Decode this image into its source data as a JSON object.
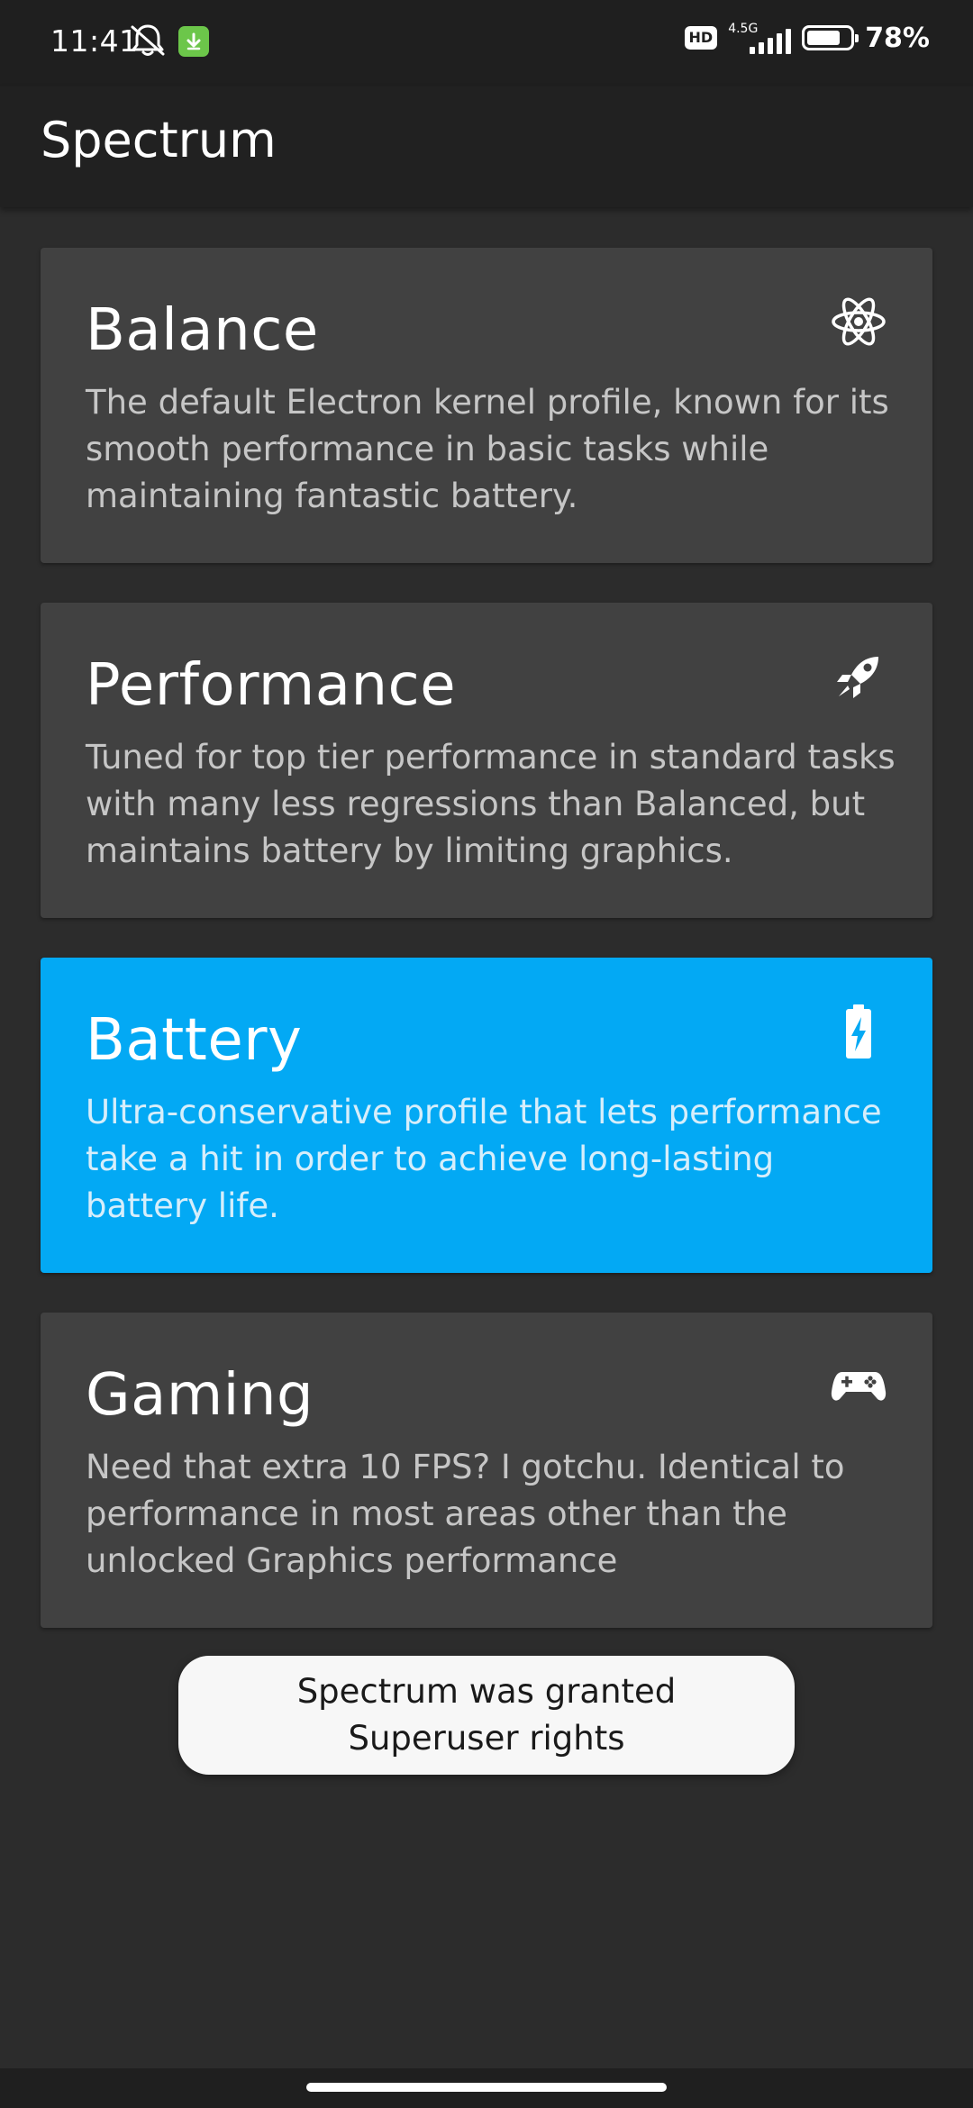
{
  "status_bar": {
    "time": "11:41",
    "hd_label": "HD",
    "network_label": "4.5G",
    "battery_percent": "78%",
    "battery_level": 0.78,
    "icons": [
      "mute-bell-icon",
      "download-icon",
      "signal-icon",
      "battery-icon"
    ]
  },
  "app_bar": {
    "title": "Spectrum"
  },
  "profiles": [
    {
      "title": "Balance",
      "description": "The default Electron kernel profile, known for its smooth performance in basic tasks while maintaining fantastic battery.",
      "icon": "atom-icon",
      "selected": false
    },
    {
      "title": "Performance",
      "description": "Tuned for top tier performance in standard tasks with many less regressions than Balanced, but maintains battery by limiting graphics.",
      "icon": "rocket-icon",
      "selected": false
    },
    {
      "title": "Battery",
      "description": "Ultra-conservative profile that lets performance take a hit in order to achieve long-lasting battery life.",
      "icon": "battery-charging-icon",
      "selected": true
    },
    {
      "title": "Gaming",
      "description": "Need that extra 10 FPS? I gotchu. Identical to performance in most areas other than the unlocked Graphics performance",
      "icon": "gamepad-icon",
      "selected": false
    }
  ],
  "toast": {
    "line1": "Spectrum was granted",
    "line2": "Superuser rights"
  },
  "colors": {
    "accent": "#03a9f4",
    "card": "#414141",
    "background": "#2c2c2c",
    "app_bar": "#212121"
  }
}
